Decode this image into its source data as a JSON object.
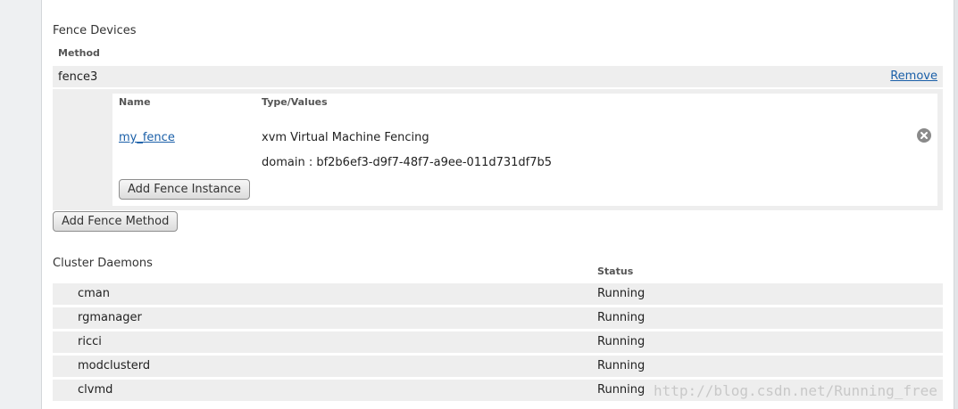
{
  "fence_devices": {
    "title": "Fence Devices",
    "method_header": "Method",
    "method": {
      "name": "fence3",
      "remove_label": "Remove"
    },
    "instance_table": {
      "col_name": "Name",
      "col_type": "Type/Values",
      "row": {
        "name": "my_fence",
        "type": "xvm Virtual Machine Fencing",
        "values": "domain : bf2b6ef3-d9f7-48f7-a9ee-011d731df7b5",
        "remove_icon": "close-circle-icon"
      }
    },
    "add_instance_label": "Add Fence Instance",
    "add_method_label": "Add Fence Method"
  },
  "cluster_daemons": {
    "title": "Cluster Daemons",
    "status_header": "Status",
    "rows": [
      {
        "name": "cman",
        "status": "Running"
      },
      {
        "name": "rgmanager",
        "status": "Running"
      },
      {
        "name": "ricci",
        "status": "Running"
      },
      {
        "name": "modclusterd",
        "status": "Running"
      },
      {
        "name": "clvmd",
        "status": "Running"
      }
    ]
  },
  "watermark": "http://blog.csdn.net/Running_free",
  "colors": {
    "link": "#1a5fa8",
    "row_bg": "#eeeeee",
    "page_bg": "#eef0f2"
  }
}
